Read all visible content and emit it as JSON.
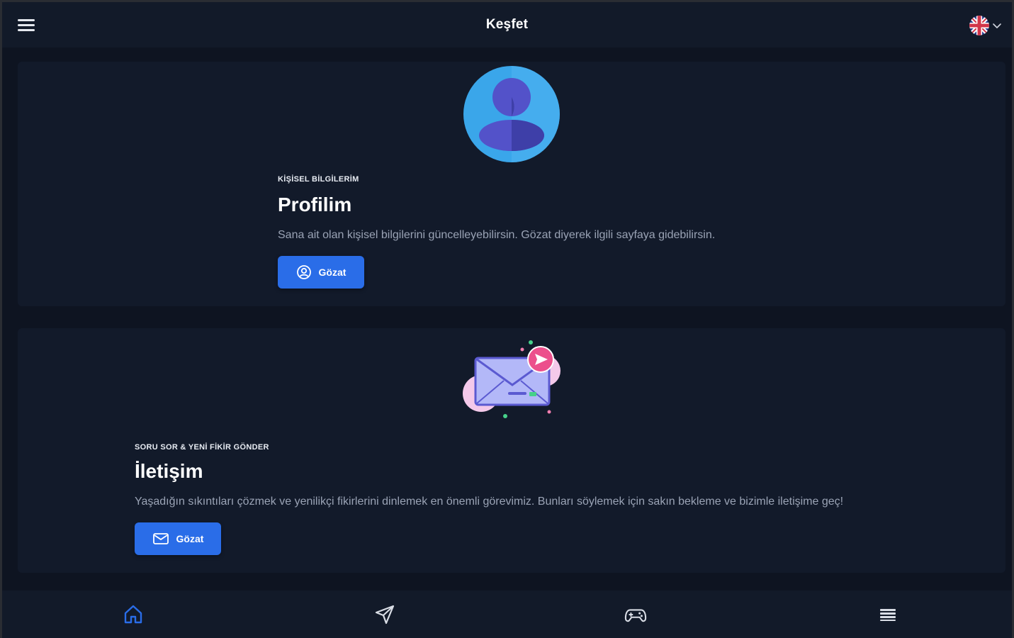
{
  "header": {
    "title": "Keşfet",
    "language_icon": "uk-flag-icon",
    "menu_icon": "hamburger-icon"
  },
  "cards": [
    {
      "eyebrow": "KİŞİSEL BİLGİLERİM",
      "title": "Profilim",
      "description": "Sana ait olan kişisel bilgilerini güncelleyebilirsin. Gözat diyerek ilgili sayfaya gidebilirsin.",
      "button_label": "Gözat",
      "icon": "user-avatar-icon"
    },
    {
      "eyebrow": "SORU SOR & YENİ FİKİR GÖNDER",
      "title": "İletişim",
      "description": "Yaşadığın sıkıntıları çözmek ve yenilikçi fikirlerini dinlemek en önemli görevimiz. Bunları söylemek için sakın bekleme ve bizimle iletişime geç!",
      "button_label": "Gözat",
      "icon": "mail-illustration-icon"
    }
  ],
  "bottom_nav": [
    {
      "name": "home",
      "icon": "home-icon",
      "active": true
    },
    {
      "name": "send",
      "icon": "send-icon",
      "active": false
    },
    {
      "name": "games",
      "icon": "gamepad-icon",
      "active": false
    },
    {
      "name": "list",
      "icon": "list-icon",
      "active": false
    }
  ],
  "colors": {
    "background": "#0e1421",
    "card": "#121a2a",
    "accent": "#2a6de8",
    "muted_text": "#9aa3b5"
  }
}
